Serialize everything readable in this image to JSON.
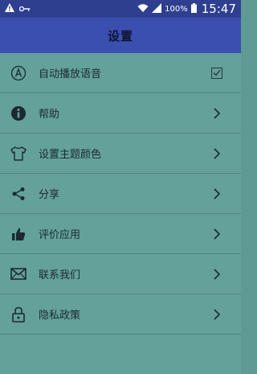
{
  "status_bar": {
    "battery_percent": "100%",
    "time": "15:47",
    "icons": [
      "warning-icon",
      "key-icon",
      "wifi-icon",
      "signal-icon",
      "battery-icon"
    ]
  },
  "header": {
    "title": "设置"
  },
  "settings": [
    {
      "label": "自动播放语音",
      "icon": "auto-play-icon",
      "trailing": "checkbox",
      "checked": true
    },
    {
      "label": "帮助",
      "icon": "info-icon",
      "trailing": "chevron"
    },
    {
      "label": "设置主题颜色",
      "icon": "shirt-icon",
      "trailing": "chevron"
    },
    {
      "label": "分享",
      "icon": "share-icon",
      "trailing": "chevron"
    },
    {
      "label": "评价应用",
      "icon": "thumbs-up-icon",
      "trailing": "chevron"
    },
    {
      "label": "联系我们",
      "icon": "mail-icon",
      "trailing": "chevron"
    },
    {
      "label": "隐私政策",
      "icon": "lock-icon",
      "trailing": "chevron"
    }
  ],
  "colors": {
    "status_bar": "#2f3f8f",
    "app_bar": "#3b4fb0",
    "list_bg": "#63a19a",
    "divider": "#4f8680"
  }
}
